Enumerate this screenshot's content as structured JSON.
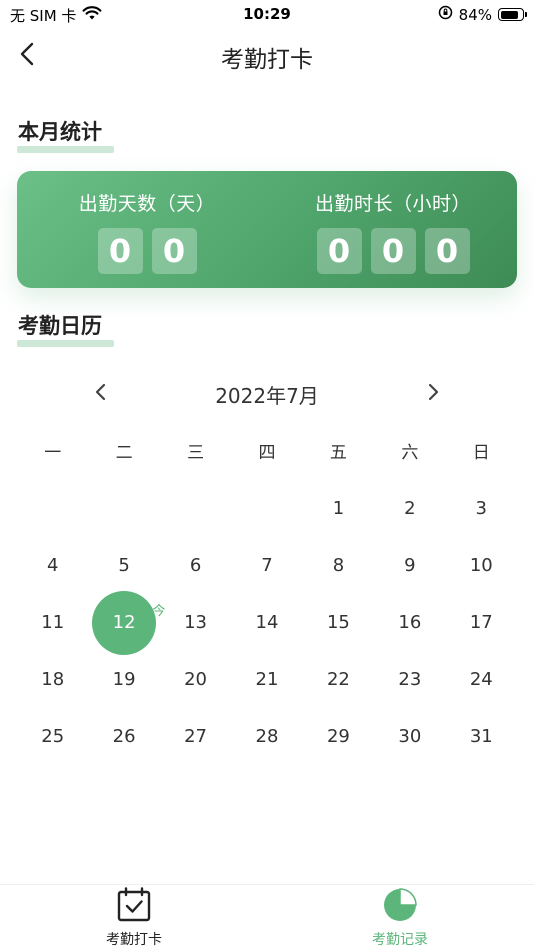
{
  "status_bar": {
    "carrier": "无 SIM 卡",
    "time": "10:29",
    "battery": "84%",
    "battery_level": 0.84,
    "icons": [
      "wifi-icon",
      "orientation-lock-icon",
      "battery-icon"
    ]
  },
  "nav": {
    "title": "考勤打卡",
    "back_icon": "chevron-left-icon"
  },
  "monthly_stats": {
    "section_title": "本月统计",
    "attendance_days": {
      "label": "出勤天数（天）",
      "digits": [
        "0",
        "0"
      ]
    },
    "attendance_hours": {
      "label": "出勤时长（小时）",
      "digits": [
        "0",
        "0",
        "0"
      ]
    }
  },
  "calendar": {
    "section_title": "考勤日历",
    "month_label": "2022年7月",
    "weekdays": [
      "一",
      "二",
      "三",
      "四",
      "五",
      "六",
      "日"
    ],
    "today": "12",
    "today_badge": "今",
    "weeks": [
      [
        "",
        "",
        "",
        "",
        "1",
        "2",
        "3"
      ],
      [
        "4",
        "5",
        "6",
        "7",
        "8",
        "9",
        "10"
      ],
      [
        "11",
        "12",
        "13",
        "14",
        "15",
        "16",
        "17"
      ],
      [
        "18",
        "19",
        "20",
        "21",
        "22",
        "23",
        "24"
      ],
      [
        "25",
        "26",
        "27",
        "28",
        "29",
        "30",
        "31"
      ]
    ]
  },
  "tabbar": {
    "items": [
      {
        "label": "考勤打卡",
        "icon": "calendar-check-icon",
        "active": false
      },
      {
        "label": "考勤记录",
        "icon": "pie-chart-icon",
        "active": true
      }
    ]
  },
  "colors": {
    "accent": "#5cb57a",
    "card_gradient_start": "#6bbf87",
    "card_gradient_end": "#3e8b55",
    "underline": "#cde8d7",
    "inactive_tab": "#222222"
  }
}
